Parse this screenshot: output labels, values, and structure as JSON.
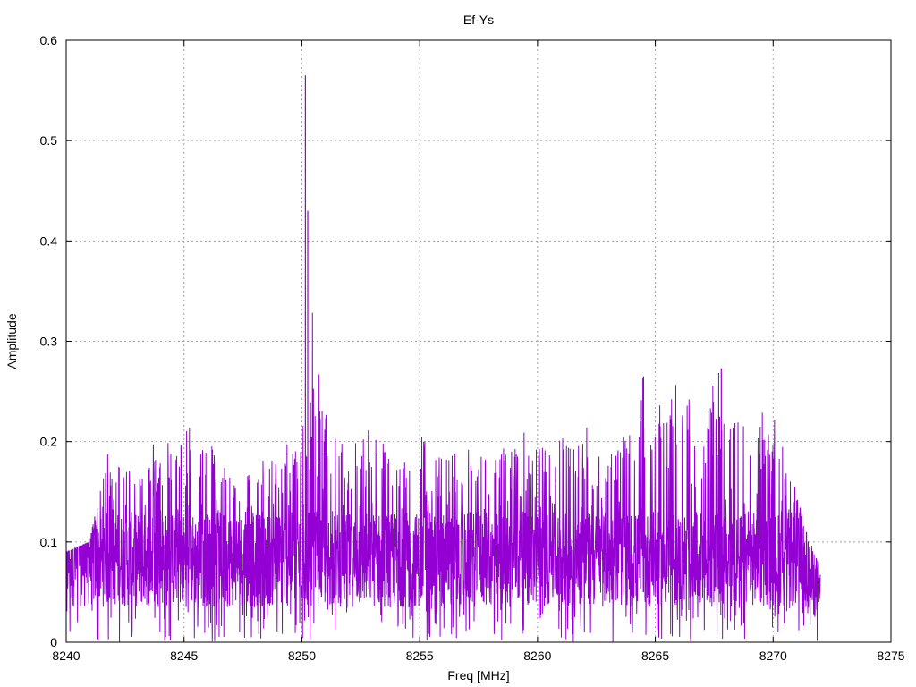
{
  "chart_data": {
    "type": "line",
    "title": "Ef-Ys",
    "xlabel": "Freq [MHz]",
    "ylabel": "Amplitude",
    "xlim": [
      8240,
      8275
    ],
    "ylim": [
      0,
      0.6
    ],
    "xticks": [
      8240,
      8245,
      8250,
      8255,
      8260,
      8265,
      8270,
      8275
    ],
    "yticks": [
      0,
      0.1,
      0.2,
      0.3,
      0.4,
      0.5,
      0.6
    ],
    "ytick_labels": [
      "0",
      "0.1",
      "0.2",
      "0.3",
      "0.4",
      "0.5",
      "0.6"
    ],
    "grid": true,
    "grid_style": "dotted",
    "series": [
      {
        "color": "#9400d3",
        "x_range": [
          8240,
          8272
        ],
        "upper_envelope": [
          [
            8240,
            0.09
          ],
          [
            8241,
            0.1
          ],
          [
            8241.8,
            0.2
          ],
          [
            8243,
            0.19
          ],
          [
            8243.6,
            0.2
          ],
          [
            8245,
            0.22
          ],
          [
            8246,
            0.21
          ],
          [
            8247,
            0.19
          ],
          [
            8248,
            0.18
          ],
          [
            8249,
            0.2
          ],
          [
            8250,
            0.21
          ],
          [
            8250.15,
            0.565
          ],
          [
            8250.25,
            0.43
          ],
          [
            8251,
            0.24
          ],
          [
            8252,
            0.2
          ],
          [
            8253,
            0.22
          ],
          [
            8254,
            0.2
          ],
          [
            8255,
            0.21
          ],
          [
            8256,
            0.2
          ],
          [
            8257,
            0.21
          ],
          [
            8258,
            0.2
          ],
          [
            8259,
            0.22
          ],
          [
            8260,
            0.21
          ],
          [
            8261,
            0.22
          ],
          [
            8262,
            0.22
          ],
          [
            8263,
            0.21
          ],
          [
            8264,
            0.23
          ],
          [
            8264.5,
            0.265
          ],
          [
            8265,
            0.23
          ],
          [
            8265.8,
            0.26
          ],
          [
            8266.5,
            0.26
          ],
          [
            8267,
            0.26
          ],
          [
            8267.8,
            0.273
          ],
          [
            8268.5,
            0.25
          ],
          [
            8269,
            0.24
          ],
          [
            8270,
            0.23
          ],
          [
            8271,
            0.15
          ],
          [
            8272,
            0.12
          ]
        ],
        "dense_band": [
          0.035,
          0.13
        ],
        "spikes": [
          {
            "x": 8250.15,
            "y": 0.565
          },
          {
            "x": 8250.25,
            "y": 0.43
          },
          {
            "x": 8264.5,
            "y": 0.265
          },
          {
            "x": 8267.8,
            "y": 0.273
          }
        ]
      }
    ]
  }
}
